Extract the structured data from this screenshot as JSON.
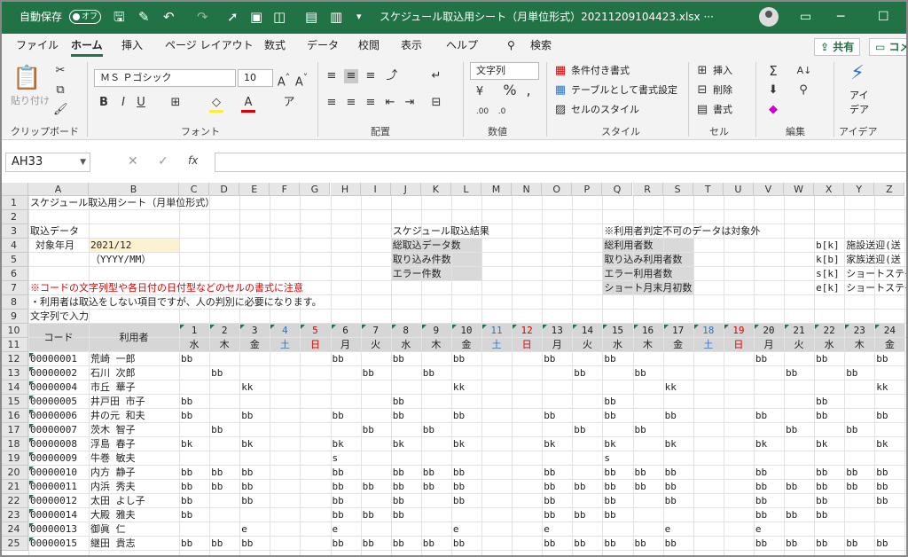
{
  "titlebar": {
    "autosave_label": "自動保存",
    "autosave_state": "オフ",
    "filename": "スケジュール取込用シート（月単位形式）20211209104423.xlsx  ···"
  },
  "tabs": [
    "ファイル",
    "ホーム",
    "挿入",
    "ページ レイアウト",
    "数式",
    "データ",
    "校閲",
    "表示",
    "ヘルプ"
  ],
  "search_label": "検索",
  "share_label": "共有",
  "comment_label": "コメ",
  "ribbon": {
    "paste": "貼り付け",
    "clipboard": "クリップボード",
    "font_name": "ＭＳ Ｐゴシック",
    "font_size": "10",
    "font": "フォント",
    "align": "配置",
    "number_format": "文字列",
    "number": "数値",
    "cond": "条件付き書式",
    "table": "テーブルとして書式設定",
    "cellstyle": "セルのスタイル",
    "style": "スタイル",
    "insert": "挿入",
    "delete": "削除",
    "format": "書式",
    "cell": "セル",
    "edit": "編集",
    "idea1": "アイ",
    "idea2": "デア",
    "idea": "アイデア"
  },
  "formula": {
    "namebox": "AH33",
    "fx": "fx",
    "x": "✕",
    "check": "✓"
  },
  "columns": [
    "A",
    "B",
    "C",
    "D",
    "E",
    "F",
    "G",
    "H",
    "I",
    "J",
    "K",
    "L",
    "M",
    "N",
    "O",
    "P",
    "Q",
    "R",
    "S",
    "T",
    "U",
    "V",
    "W",
    "X",
    "Y",
    "Z"
  ],
  "rownums": [
    "1",
    "2",
    "3",
    "4",
    "5",
    "6",
    "7",
    "8",
    "9",
    "10",
    "11",
    "12",
    "13",
    "14",
    "15",
    "16",
    "17",
    "18",
    "19",
    "20",
    "21",
    "22",
    "23",
    "24",
    "25"
  ],
  "sheet": {
    "r1": "スケジュール取込用シート（月単位形式）",
    "r3a": "取込データ",
    "r4a": "対象年月",
    "r4b": "2021/12",
    "r5b": "（YYYY/MM）",
    "j3": "スケジュール取込結果",
    "j4": "総取込データ数",
    "j5": "取り込み件数",
    "j6": "エラー件数",
    "q3": "※利用者判定不可のデータは対象外",
    "q4": "総利用者数",
    "q5": "取り込み利用者数",
    "q6": "エラー利用者数",
    "q7": "ショート月末月初数",
    "x4": "b[k]",
    "x5": "k[b]",
    "x6": "s[k]",
    "x7": "e[k]",
    "y4": "施設送迎(送",
    "y5": "家族送迎(送",
    "y6": "ショートステイ",
    "y7": "ショートステイ",
    "r7": "※コードの文字列型や各日付の日付型などのセルの書式に注意",
    "r8": "・利用者は取込をしない項目ですが、人の判別に必要になります。",
    "r9": "文字列で入力",
    "code_header": "コード",
    "user_header": "利用者"
  },
  "days": [
    {
      "n": "1",
      "w": "水",
      "k": ""
    },
    {
      "n": "2",
      "w": "木",
      "k": ""
    },
    {
      "n": "3",
      "w": "金",
      "k": ""
    },
    {
      "n": "4",
      "w": "土",
      "k": "sat"
    },
    {
      "n": "5",
      "w": "日",
      "k": "sun"
    },
    {
      "n": "6",
      "w": "月",
      "k": ""
    },
    {
      "n": "7",
      "w": "火",
      "k": ""
    },
    {
      "n": "8",
      "w": "水",
      "k": ""
    },
    {
      "n": "9",
      "w": "木",
      "k": ""
    },
    {
      "n": "10",
      "w": "金",
      "k": ""
    },
    {
      "n": "11",
      "w": "土",
      "k": "sat"
    },
    {
      "n": "12",
      "w": "日",
      "k": "sun"
    },
    {
      "n": "13",
      "w": "月",
      "k": ""
    },
    {
      "n": "14",
      "w": "火",
      "k": ""
    },
    {
      "n": "15",
      "w": "水",
      "k": ""
    },
    {
      "n": "16",
      "w": "木",
      "k": ""
    },
    {
      "n": "17",
      "w": "金",
      "k": ""
    },
    {
      "n": "18",
      "w": "土",
      "k": "sat"
    },
    {
      "n": "19",
      "w": "日",
      "k": "sun"
    },
    {
      "n": "20",
      "w": "月",
      "k": ""
    },
    {
      "n": "21",
      "w": "火",
      "k": ""
    },
    {
      "n": "22",
      "w": "水",
      "k": ""
    },
    {
      "n": "23",
      "w": "木",
      "k": ""
    },
    {
      "n": "24",
      "w": "金",
      "k": ""
    }
  ],
  "rows": [
    {
      "code": "00000001",
      "name": "荒崎 一郎",
      "d": [
        "bb",
        "",
        "",
        "",
        "",
        "bb",
        "",
        "bb",
        "",
        "bb",
        "",
        "",
        "bb",
        "",
        "bb",
        "",
        "",
        "",
        "",
        "bb",
        "",
        "bb",
        "",
        "bb"
      ]
    },
    {
      "code": "00000002",
      "name": "石川 次郎",
      "d": [
        "",
        "bb",
        "",
        "",
        "",
        "",
        "bb",
        "",
        "bb",
        "",
        "",
        "",
        "",
        "bb",
        "",
        "bb",
        "",
        "",
        "",
        "",
        "bb",
        "",
        "bb",
        ""
      ]
    },
    {
      "code": "00000004",
      "name": "市丘 華子",
      "d": [
        "",
        "",
        "kk",
        "",
        "",
        "",
        "",
        "",
        "",
        "kk",
        "",
        "",
        "",
        "",
        "",
        "",
        "kk",
        "",
        "",
        "",
        "",
        "",
        "",
        "kk"
      ]
    },
    {
      "code": "00000005",
      "name": "井戸田 市子",
      "d": [
        "bb",
        "",
        "",
        "",
        "",
        "",
        "",
        "bb",
        "",
        "",
        "",
        "",
        "",
        "",
        "bb",
        "",
        "",
        "",
        "",
        "",
        "",
        "bb",
        "",
        ""
      ]
    },
    {
      "code": "00000006",
      "name": "井の元 和夫",
      "d": [
        "bb",
        "",
        "bb",
        "",
        "",
        "bb",
        "",
        "bb",
        "",
        "bb",
        "",
        "",
        "bb",
        "",
        "bb",
        "",
        "bb",
        "",
        "",
        "bb",
        "",
        "bb",
        "",
        "bb"
      ]
    },
    {
      "code": "00000007",
      "name": "茨木 智子",
      "d": [
        "",
        "bb",
        "",
        "",
        "",
        "",
        "bb",
        "",
        "bb",
        "",
        "",
        "",
        "",
        "bb",
        "",
        "bb",
        "",
        "",
        "",
        "",
        "bb",
        "",
        "bb",
        ""
      ]
    },
    {
      "code": "00000008",
      "name": "浮島 春子",
      "d": [
        "bk",
        "",
        "bk",
        "",
        "",
        "bk",
        "",
        "bk",
        "",
        "bk",
        "",
        "",
        "bk",
        "",
        "bk",
        "",
        "bk",
        "",
        "",
        "bk",
        "",
        "bk",
        "",
        "bk"
      ]
    },
    {
      "code": "00000009",
      "name": "牛巻 敏夫",
      "d": [
        "",
        "",
        "",
        "",
        "",
        "s",
        "",
        "",
        "",
        "",
        "",
        "",
        "",
        "",
        "s",
        "",
        "",
        "",
        "",
        "",
        "",
        "",
        "",
        ""
      ]
    },
    {
      "code": "00000010",
      "name": "内方 静子",
      "d": [
        "bb",
        "bb",
        "bb",
        "",
        "",
        "bb",
        "",
        "bb",
        "bb",
        "bb",
        "",
        "",
        "bb",
        "",
        "bb",
        "bb",
        "bb",
        "",
        "",
        "bb",
        "",
        "bb",
        "bb",
        "bb"
      ]
    },
    {
      "code": "00000011",
      "name": "内浜 秀夫",
      "d": [
        "bb",
        "bb",
        "bb",
        "",
        "",
        "bb",
        "bb",
        "bb",
        "bb",
        "bb",
        "",
        "",
        "bb",
        "bb",
        "bb",
        "bb",
        "bb",
        "",
        "",
        "bb",
        "bb",
        "bb",
        "bb",
        "bb"
      ]
    },
    {
      "code": "00000012",
      "name": "太田 よし子",
      "d": [
        "bb",
        "",
        "bb",
        "",
        "",
        "bb",
        "",
        "bb",
        "",
        "bb",
        "",
        "",
        "bb",
        "",
        "bb",
        "",
        "bb",
        "",
        "",
        "bb",
        "",
        "bb",
        "",
        "bb"
      ]
    },
    {
      "code": "00000014",
      "name": "大殿 雅夫",
      "d": [
        "bb",
        "",
        "",
        "",
        "",
        "bb",
        "bb",
        "bb",
        "",
        "",
        "",
        "",
        "bb",
        "bb",
        "bb",
        "",
        "",
        "",
        "",
        "bb",
        "bb",
        "bb",
        "",
        ""
      ]
    },
    {
      "code": "00000013",
      "name": "御眞 仁",
      "d": [
        "",
        "",
        "e",
        "",
        "",
        "e",
        "",
        "",
        "",
        "e",
        "",
        "",
        "e",
        "",
        "",
        "",
        "e",
        "",
        "",
        "e",
        "",
        "",
        "",
        ""
      ]
    },
    {
      "code": "00000015",
      "name": "継田 貴志",
      "d": [
        "bb",
        "bb",
        "bb",
        "",
        "",
        "bb",
        "bb",
        "bb",
        "bb",
        "bb",
        "",
        "",
        "bb",
        "bb",
        "bb",
        "bb",
        "bb",
        "",
        "",
        "bb",
        "bb",
        "bb",
        "bb",
        "bb"
      ]
    }
  ]
}
